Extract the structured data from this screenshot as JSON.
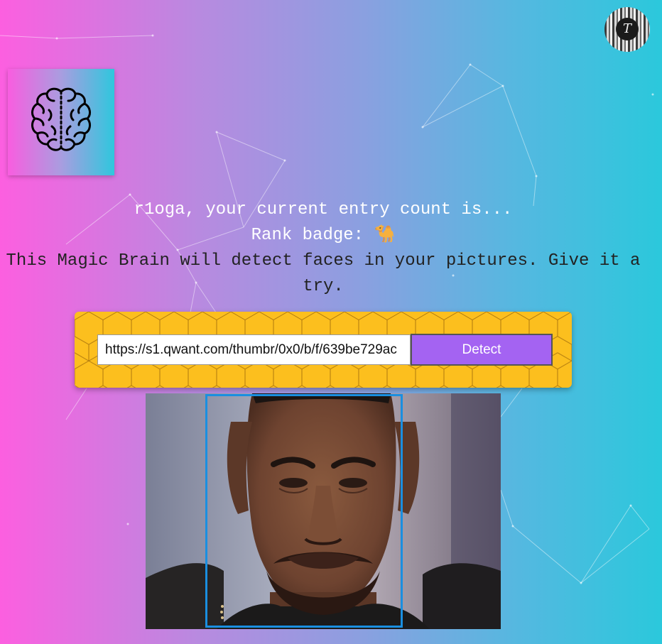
{
  "user": {
    "avatar_initial": "T",
    "name": "r1oga"
  },
  "header": {
    "entry_text": "r1oga, your current entry count is...",
    "rank_text": "Rank badge: 🐪",
    "description": "This Magic Brain will detect faces in your pictures. Give it a try."
  },
  "form": {
    "url_value": "https://s1.qwant.com/thumbr/0x0/b/f/639be729ac",
    "detect_label": "Detect"
  },
  "icons": {
    "logo": "brain-icon",
    "avatar": "user-avatar-icon"
  },
  "colors": {
    "bg_left": "#fc5fe0",
    "bg_right": "#2bc8dc",
    "form_bg": "#fcbf1e",
    "button_bg": "#a463f2",
    "face_box": "#1a8fe0"
  }
}
